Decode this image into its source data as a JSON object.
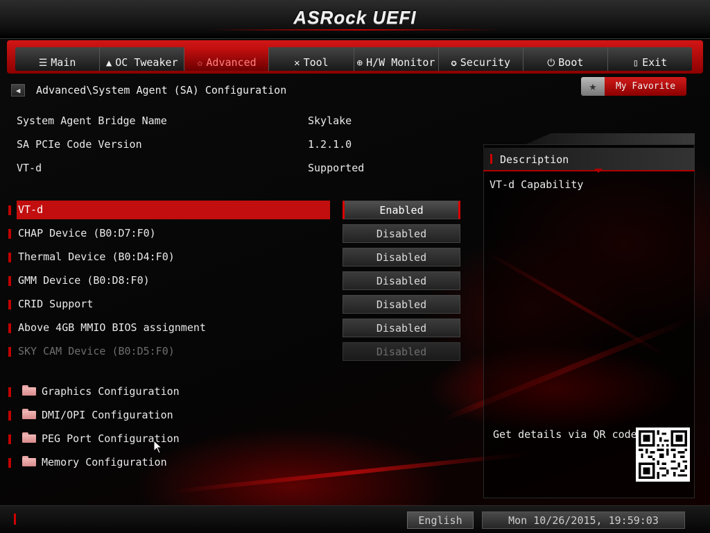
{
  "app": {
    "logo": "ASRock UEFI"
  },
  "nav": {
    "tabs": [
      {
        "label": "Main",
        "icon": "list-icon",
        "glyph": "☰"
      },
      {
        "label": "OC Tweaker",
        "icon": "rocket-icon",
        "glyph": "▲"
      },
      {
        "label": "Advanced",
        "icon": "star-icon",
        "glyph": "✩"
      },
      {
        "label": "Tool",
        "icon": "tools-icon",
        "glyph": "✕"
      },
      {
        "label": "H/W Monitor",
        "icon": "monitor-icon",
        "glyph": "⊕"
      },
      {
        "label": "Security",
        "icon": "shield-icon",
        "glyph": "✪"
      },
      {
        "label": "Boot",
        "icon": "power-icon",
        "glyph": "⏻"
      },
      {
        "label": "Exit",
        "icon": "exit-icon",
        "glyph": "▯"
      }
    ],
    "active": "Advanced"
  },
  "breadcrumb": "Advanced\\System Agent (SA) Configuration",
  "favorite": {
    "label": "My Favorite"
  },
  "info": [
    {
      "key": "System Agent Bridge Name",
      "value": "Skylake"
    },
    {
      "key": "SA PCIe Code Version",
      "value": "1.2.1.0"
    },
    {
      "key": "VT-d",
      "value": "Supported"
    }
  ],
  "settings": [
    {
      "name": "VT-d",
      "value": "Enabled"
    },
    {
      "name": "CHAP Device (B0:D7:F0)",
      "value": "Disabled"
    },
    {
      "name": "Thermal Device (B0:D4:F0)",
      "value": "Disabled"
    },
    {
      "name": "GMM Device (B0:D8:F0)",
      "value": "Disabled"
    },
    {
      "name": "CRID Support",
      "value": "Disabled"
    },
    {
      "name": "Above 4GB MMIO BIOS assignment",
      "value": "Disabled"
    },
    {
      "name": "SKY CAM Device (B0:D5:F0)",
      "value": "Disabled"
    }
  ],
  "folders": [
    {
      "name": "Graphics Configuration"
    },
    {
      "name": "DMI/OPI Configuration"
    },
    {
      "name": "PEG Port Configuration"
    },
    {
      "name": "Memory Configuration"
    }
  ],
  "description": {
    "title": "Description",
    "text": "VT-d Capability",
    "qr_text": "Get details via QR code"
  },
  "footer": {
    "language": "English",
    "datetime": "Mon 10/26/2015, 19:59:03"
  },
  "colors": {
    "accent": "#c20e0e",
    "background": "#000000"
  }
}
